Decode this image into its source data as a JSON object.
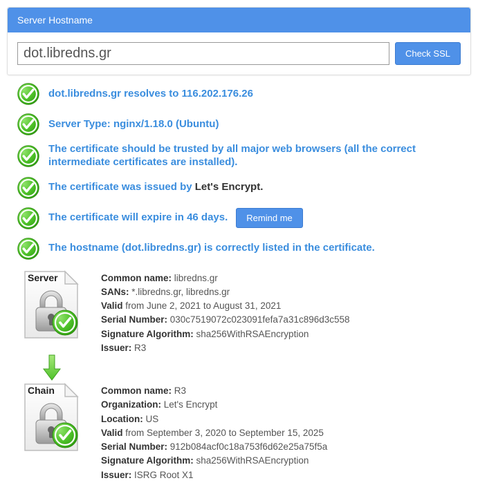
{
  "panel": {
    "title": "Server Hostname",
    "hostname_value": "dot.libredns.gr",
    "check_button": "Check SSL"
  },
  "checks": {
    "resolves_prefix": "dot.libredns.gr resolves to ",
    "resolves_ip": "116.202.176.26",
    "server_type_prefix": "Server Type: ",
    "server_type_value": "nginx/1.18.0 (Ubuntu)",
    "trusted": "The certificate should be trusted by all major web browsers (all the correct intermediate certificates are installed).",
    "issued_by_prefix": "The certificate was issued by ",
    "issued_by_value": "Let's Encrypt",
    "issued_by_suffix": ".",
    "expire": "The certificate will expire in 46 days.",
    "remind_button": "Remind me",
    "hostname_listed": "The hostname (dot.libredns.gr) is correctly listed in the certificate."
  },
  "server_cert": {
    "badge": "Server",
    "cn_label": "Common name:",
    "cn_value": " libredns.gr",
    "sans_label": "SANs:",
    "sans_value": " *.libredns.gr, libredns.gr",
    "valid_label": "Valid",
    "valid_value": " from June 2, 2021 to August 31, 2021",
    "serial_label": "Serial Number:",
    "serial_value": " 030c7519072c023091fefa7a31c896d3c558",
    "sig_label": "Signature Algorithm:",
    "sig_value": " sha256WithRSAEncryption",
    "issuer_label": "Issuer:",
    "issuer_value": " R3"
  },
  "chain_cert": {
    "badge": "Chain",
    "cn_label": "Common name:",
    "cn_value": " R3",
    "org_label": "Organization:",
    "org_value": " Let's Encrypt",
    "loc_label": "Location:",
    "loc_value": " US",
    "valid_label": "Valid",
    "valid_value": " from September 3, 2020 to September 15, 2025",
    "serial_label": "Serial Number:",
    "serial_value": " 912b084acf0c18a753f6d62e25a75f5a",
    "sig_label": "Signature Algorithm:",
    "sig_value": " sha256WithRSAEncryption",
    "issuer_label": "Issuer:",
    "issuer_value": " ISRG Root X1"
  }
}
